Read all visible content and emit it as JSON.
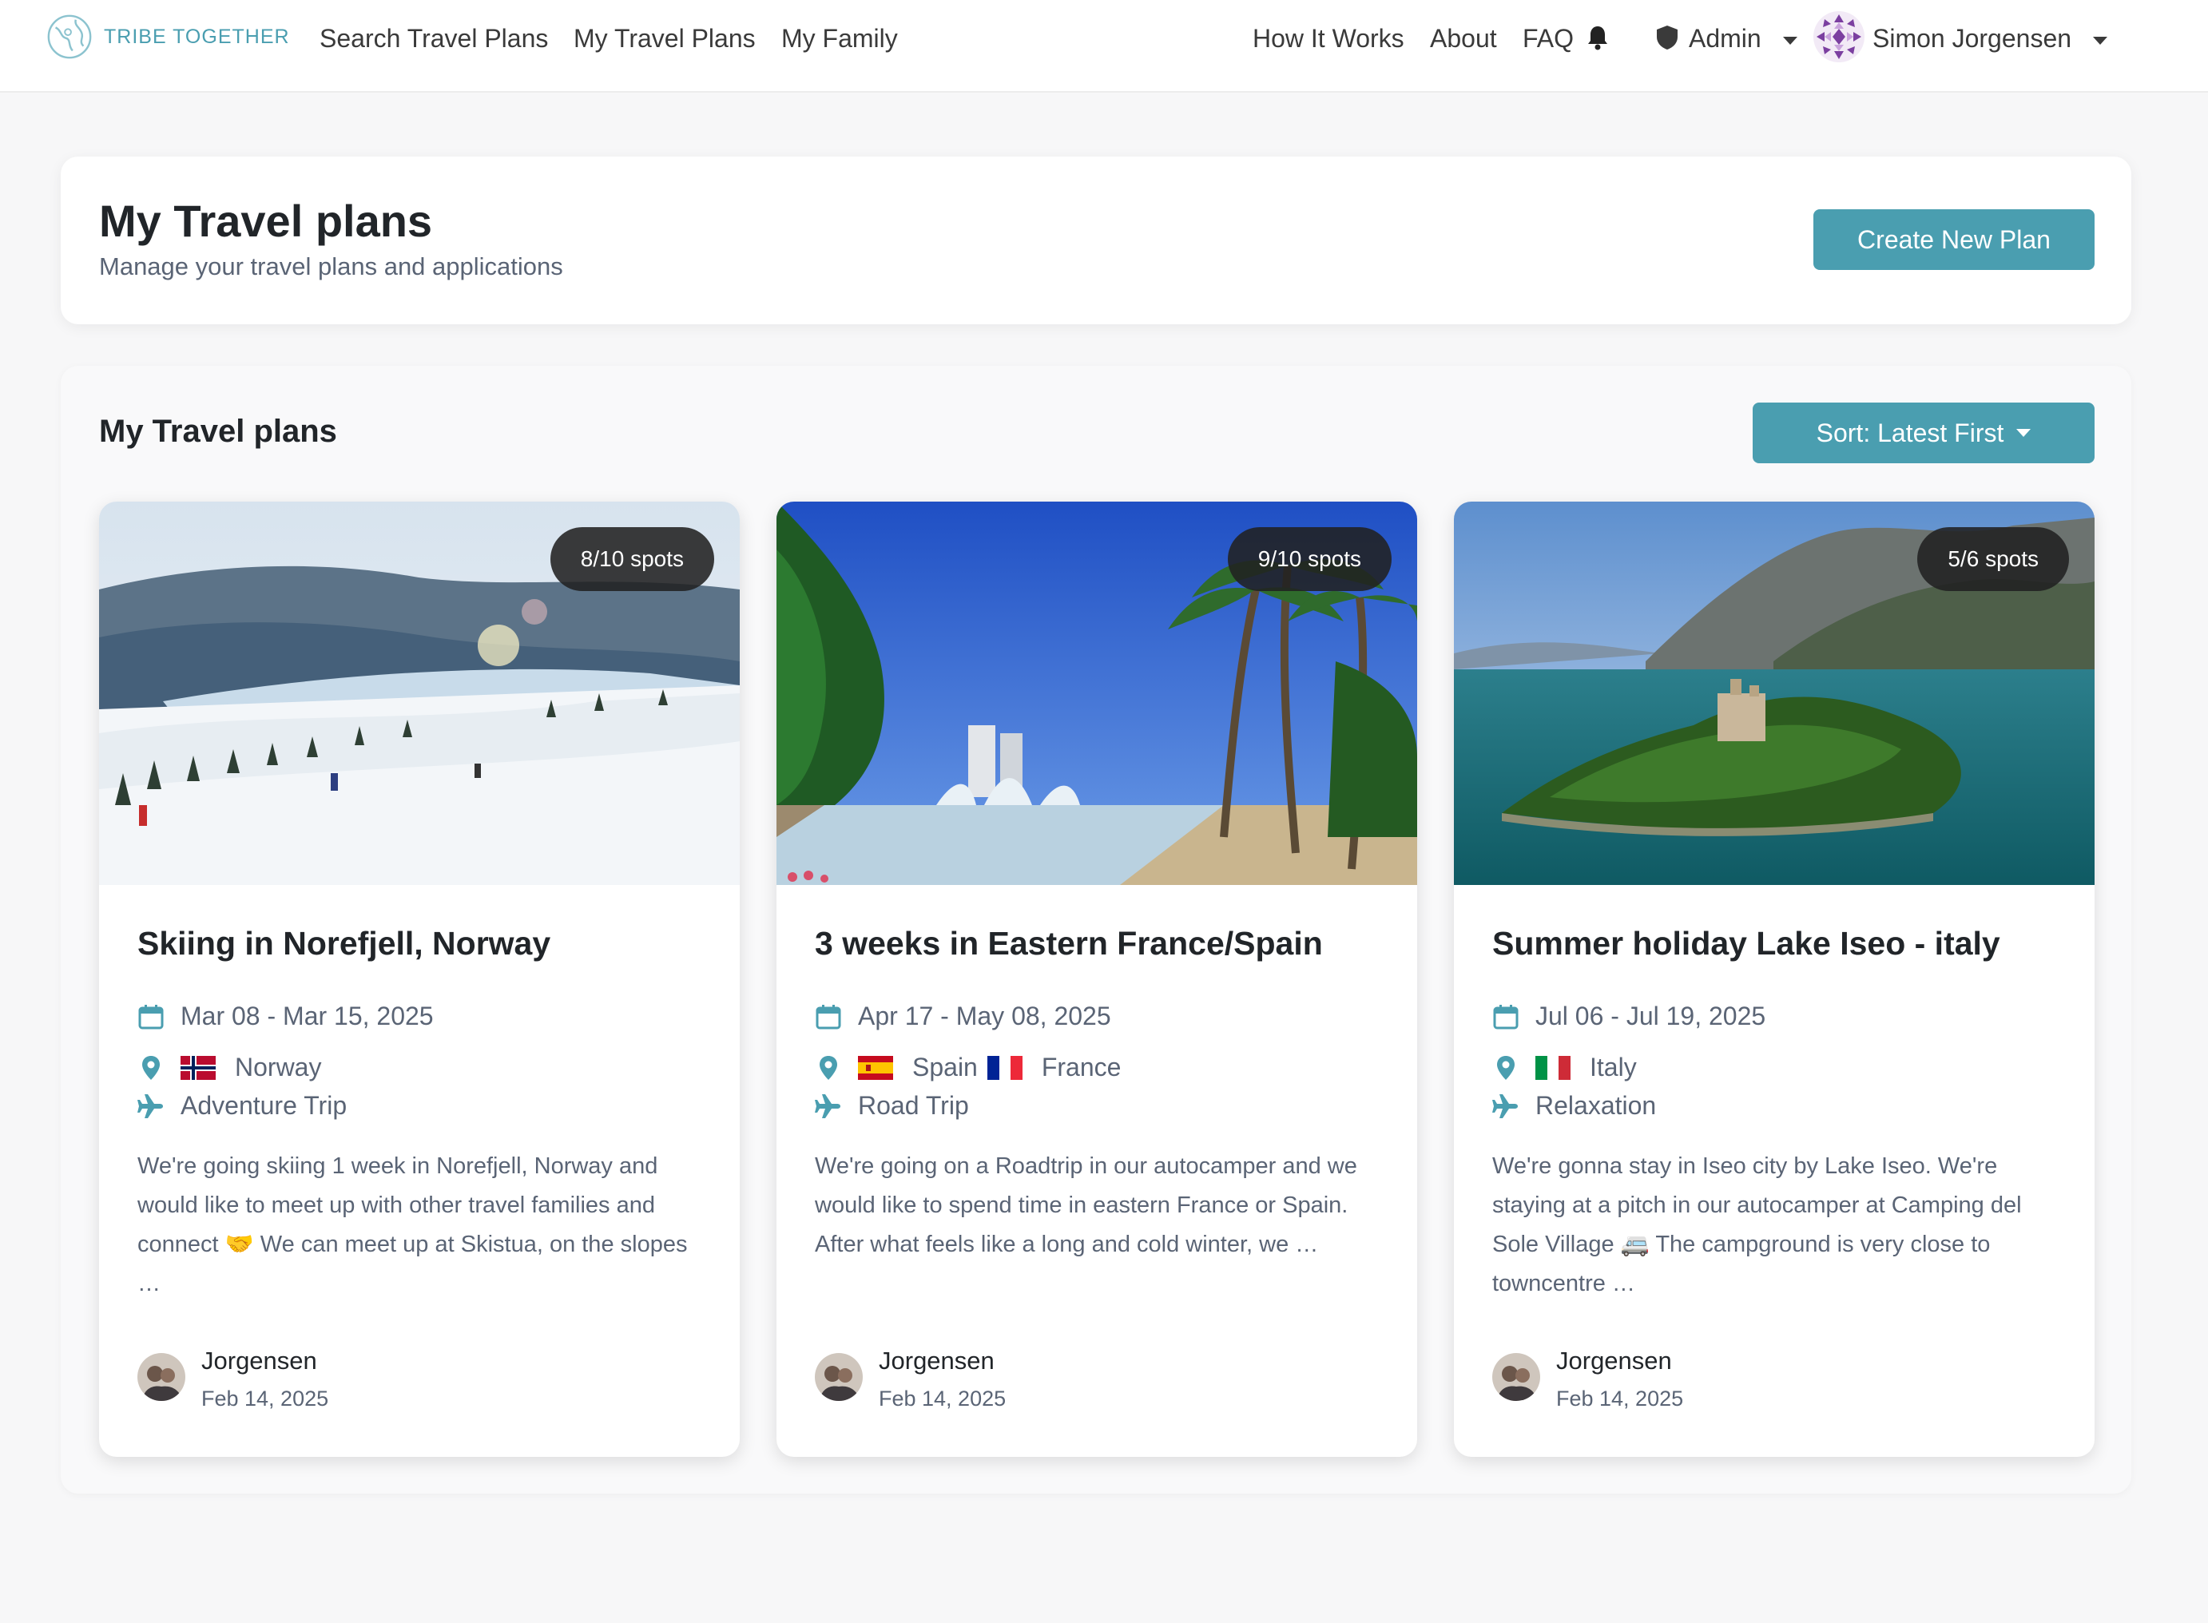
{
  "nav": {
    "brand": "TRIBE TOGETHER",
    "links": [
      "Search Travel Plans",
      "My Travel Plans",
      "My Family",
      "How It Works",
      "About",
      "FAQ"
    ],
    "admin": "Admin",
    "user_name": "Simon Jorgensen",
    "icons": {
      "bell": "bell-icon",
      "shield": "shield-icon"
    }
  },
  "header": {
    "title": "My Travel plans",
    "subtitle": "Manage your travel plans and applications",
    "create_button": "Create New Plan"
  },
  "plans": {
    "title": "My Travel plans",
    "sort_label": "Sort: Latest First",
    "cards": [
      {
        "spots": "8/10 spots",
        "title": "Skiing in Norefjell, Norway",
        "dates": "Mar 08 - Mar 15, 2025",
        "countries": [
          "Norway"
        ],
        "trip_type": "Adventure Trip",
        "description": "We're going skiing 1 week in Norefjell, Norway and would like to meet up with other travel families and connect 🤝 We can meet up at Skistua, on the slopes …",
        "author": "Jorgensen",
        "date": "Feb 14, 2025"
      },
      {
        "spots": "9/10 spots",
        "title": "3 weeks in Eastern France/Spain",
        "dates": "Apr 17 - May 08, 2025",
        "countries": [
          "Spain",
          "France"
        ],
        "trip_type": "Road Trip",
        "description": "We're going on a Roadtrip in our autocamper and we would like to spend time in eastern France or Spain. After what feels like a long and cold winter, we …",
        "author": "Jorgensen",
        "date": "Feb 14, 2025"
      },
      {
        "spots": "5/6 spots",
        "title": "Summer holiday Lake Iseo - italy",
        "dates": "Jul 06 - Jul 19, 2025",
        "countries": [
          "Italy"
        ],
        "trip_type": "Relaxation",
        "description": "We're gonna stay in Iseo city by Lake Iseo. We're staying at a pitch in our autocamper at Camping del Sole Village 🚐 The campground is very close to towncentre …",
        "author": "Jorgensen",
        "date": "Feb 14, 2025"
      }
    ]
  },
  "colors": {
    "accent": "#4a9eb0",
    "text_muted": "#5a6475"
  }
}
